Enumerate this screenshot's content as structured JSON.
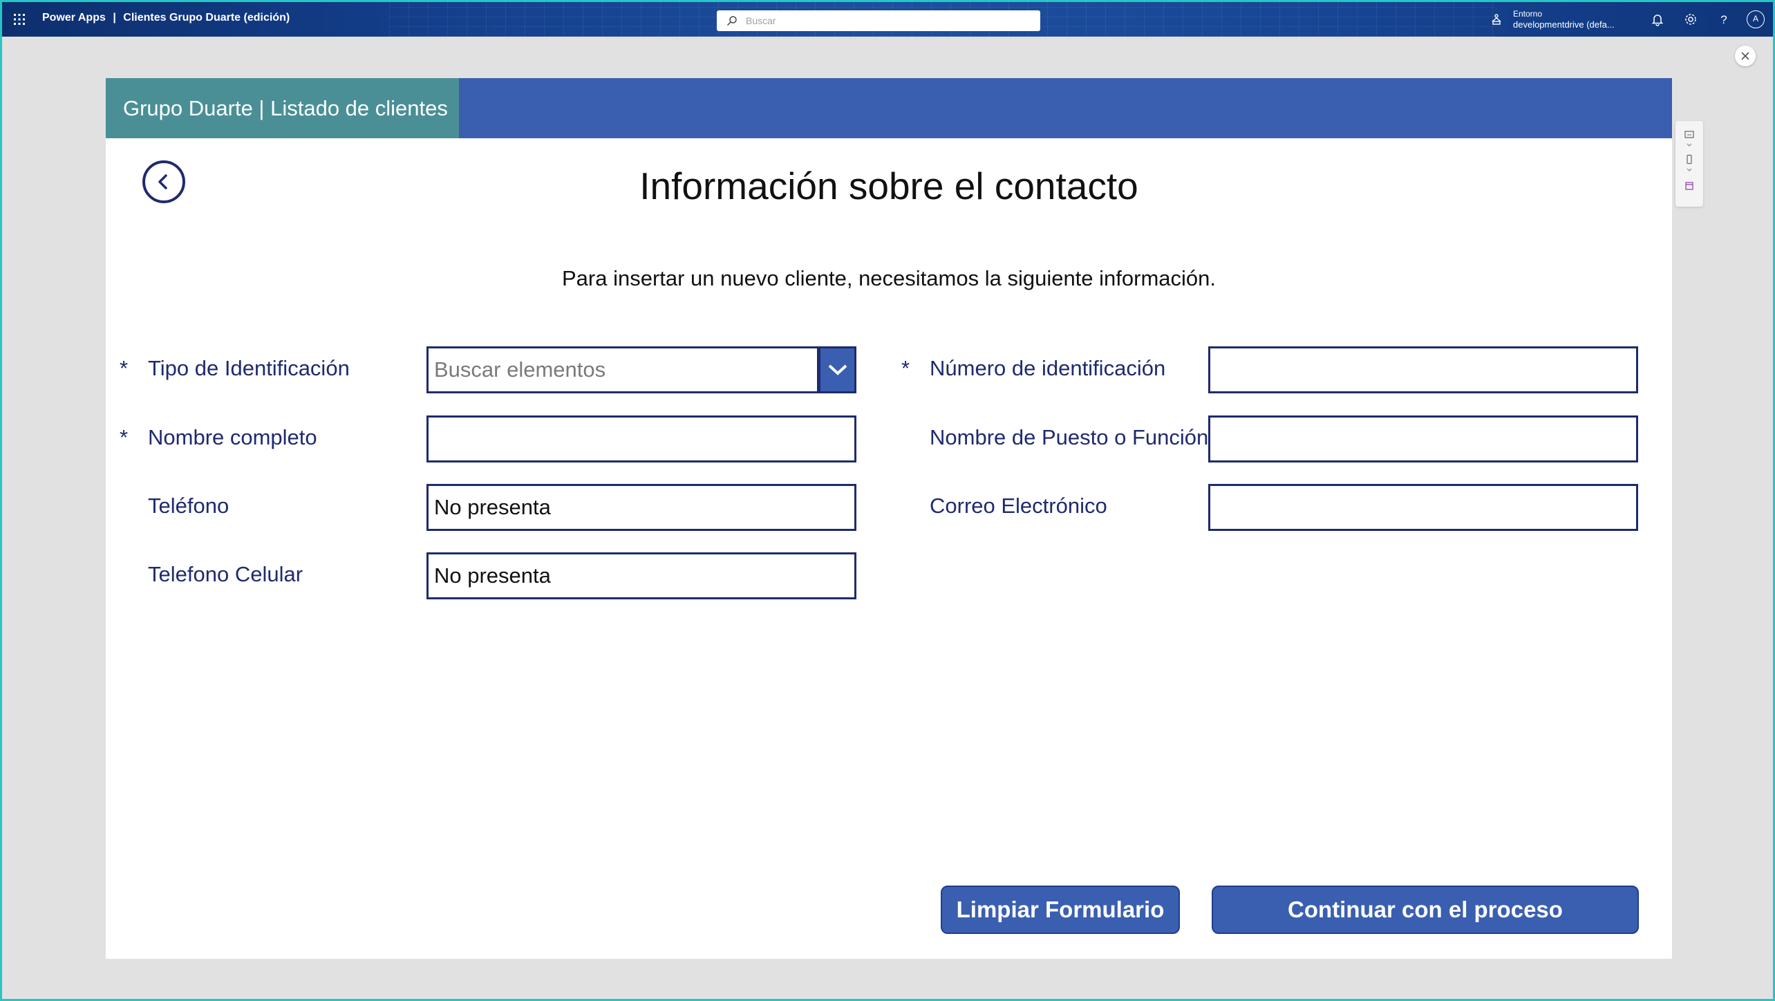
{
  "topbar": {
    "app_name": "Power Apps",
    "separator": "|",
    "doc_title": "Clientes Grupo Duarte (edición)",
    "search_placeholder": "Buscar",
    "env_label": "Entorno",
    "env_name": "developmentdrive (defa...",
    "avatar_initial": "A"
  },
  "app": {
    "header_title": "Grupo Duarte | Listado de clientes",
    "page_title": "Información sobre el contacto",
    "subtitle": "Para insertar un nuevo cliente, necesitamos la siguiente información.",
    "required_mark": "*",
    "fields": {
      "tipo_identificacion": {
        "label": "Tipo de Identificación",
        "placeholder": "Buscar elementos",
        "required": true
      },
      "numero_identificacion": {
        "label": "Número de identificación",
        "value": "",
        "required": true
      },
      "nombre_completo": {
        "label": "Nombre completo",
        "value": "",
        "required": true
      },
      "puesto": {
        "label": "Nombre de Puesto o Función",
        "value": ""
      },
      "telefono": {
        "label": "Teléfono",
        "value": "No presenta"
      },
      "correo": {
        "label": "Correo Electrónico",
        "value": ""
      },
      "celular": {
        "label": "Telefono Celular",
        "value": "No presenta"
      }
    },
    "buttons": {
      "clear": "Limpiar Formulario",
      "continue": "Continuar con el proceso"
    }
  },
  "colors": {
    "header_blue": "#3a5fb0",
    "header_teal": "#4a8f96",
    "label_navy": "#1f2a6e"
  },
  "icons": [
    "waffle-icon",
    "search-icon",
    "environment-icon",
    "bell-icon",
    "gear-icon",
    "help-icon",
    "close-icon",
    "back-arrow-icon",
    "chevron-down-icon"
  ]
}
